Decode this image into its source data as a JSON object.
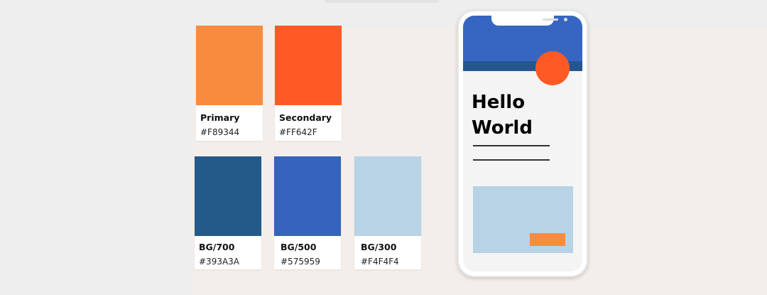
{
  "palette": {
    "row1": [
      {
        "label": "Primary",
        "hex": "#F89344",
        "color": "#f98b3e"
      },
      {
        "label": "Secondary",
        "hex": "#FF642F",
        "color": "#ff5a26"
      }
    ],
    "row2": [
      {
        "label": "BG/700",
        "hex": "#393A3A",
        "color": "#235a89"
      },
      {
        "label": "BG/500",
        "hex": "#575959",
        "color": "#3462bd"
      },
      {
        "label": "BG/300",
        "hex": "#F4F4F4",
        "color": "#b8d3e6"
      }
    ]
  },
  "phone": {
    "headline_line1": "Hello",
    "headline_line2": "World",
    "colors": {
      "hero": "#3766c2",
      "band": "#24578f",
      "accent": "#ff5a26",
      "block": "#b8d3e6",
      "cta": "#f98b3e"
    }
  }
}
